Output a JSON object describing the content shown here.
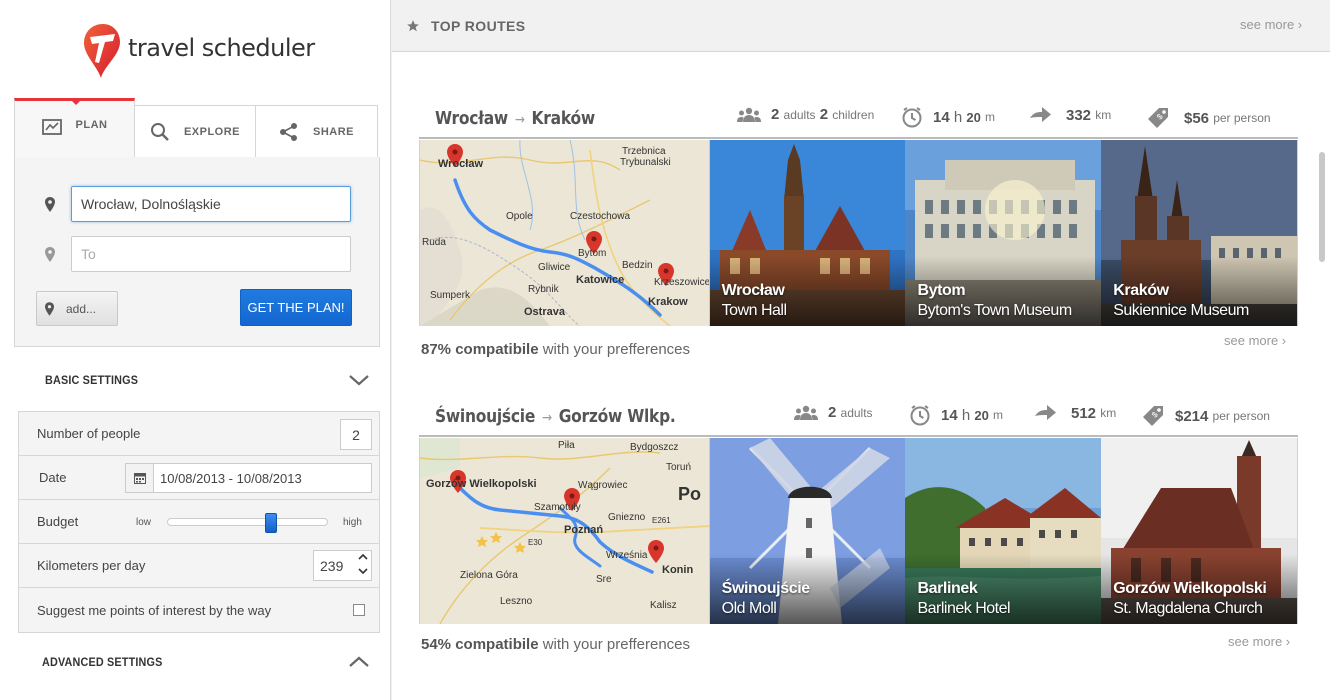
{
  "app": {
    "name": "travel scheduler"
  },
  "tabs": [
    {
      "label": "PLAN",
      "icon": "map-icon"
    },
    {
      "label": "EXPLORE",
      "icon": "search-icon"
    },
    {
      "label": "SHARE",
      "icon": "share-icon"
    }
  ],
  "plan": {
    "from_value": "Wrocław, Dolnośląskie",
    "to_placeholder": "To",
    "add_label": "add...",
    "get_plan_label": "GET THE PLAN!"
  },
  "basic_settings": {
    "title": "BASIC SETTINGS",
    "people_label": "Number of people",
    "people_value": "2",
    "date_label": "Date",
    "date_value": "10/08/2013 - 10/08/2013",
    "budget_label": "Budget",
    "budget_low": "low",
    "budget_high": "high",
    "budget_level": 0.66,
    "km_label": "Kilometers per day",
    "km_value": "239",
    "suggest_label": "Suggest me points of interest by the way",
    "suggest_checked": false
  },
  "advanced_settings": {
    "title": "ADVANCED SETTINGS"
  },
  "main": {
    "title": "TOP ROUTES",
    "see_more": "see more ›"
  },
  "routes": [
    {
      "from": "Wrocław",
      "to": "Kraków",
      "adults": "2",
      "adults_label": "adults",
      "children": "2",
      "children_label": "children",
      "hours": "14",
      "hours_unit": "h",
      "minutes": "20",
      "minutes_unit": "m",
      "distance": "332",
      "distance_unit": "km",
      "price": "$56",
      "price_suffix": "per person",
      "compat_pct": "87% compatibile",
      "compat_rest": "with your prefferences",
      "see_more": "see more ›",
      "map_labels": [
        "Wrocław",
        "Trzebnica",
        "Trybunalski",
        "Opole",
        "Czestochowa",
        "Ruda",
        "Bytom",
        "Bedzin",
        "Gliwice",
        "Katowice",
        "Krzeszowice",
        "Rybnik",
        "Krakow",
        "Sumperk",
        "Ostrava"
      ],
      "photos": [
        {
          "title": "Wrocław",
          "sub": "Town Hall"
        },
        {
          "title": "Bytom",
          "sub": "Bytom's Town Museum"
        },
        {
          "title": "Kraków",
          "sub": "Sukiennice Museum"
        }
      ]
    },
    {
      "from": "Świnoujście",
      "to": "Gorzów Wlkp.",
      "adults": "2",
      "adults_label": "adults",
      "hours": "14",
      "hours_unit": "h",
      "minutes": "20",
      "minutes_unit": "m",
      "distance": "512",
      "distance_unit": "km",
      "price": "$214",
      "price_suffix": "per person",
      "compat_pct": "54% compatibile",
      "compat_rest": "with your prefferences",
      "see_more": "see more ›",
      "map_labels": [
        "Bydgoszcz",
        "Piła",
        "Toruń",
        "Gorzów Wielkopolski",
        "Wągrowiec",
        "Szamotuły",
        "Gniezno",
        "Po",
        "Poznań",
        "E261",
        "E30",
        "Września",
        "Konin",
        "Zielona Góra",
        "Leszno",
        "Kalisz",
        "Sre"
      ],
      "photos": [
        {
          "title": "Świnoujście",
          "sub": "Old Moll"
        },
        {
          "title": "Barlinek",
          "sub": "Barlinek Hotel"
        },
        {
          "title": "Gorzów Wielkopolski",
          "sub": "St. Magdalena Church"
        }
      ]
    }
  ]
}
